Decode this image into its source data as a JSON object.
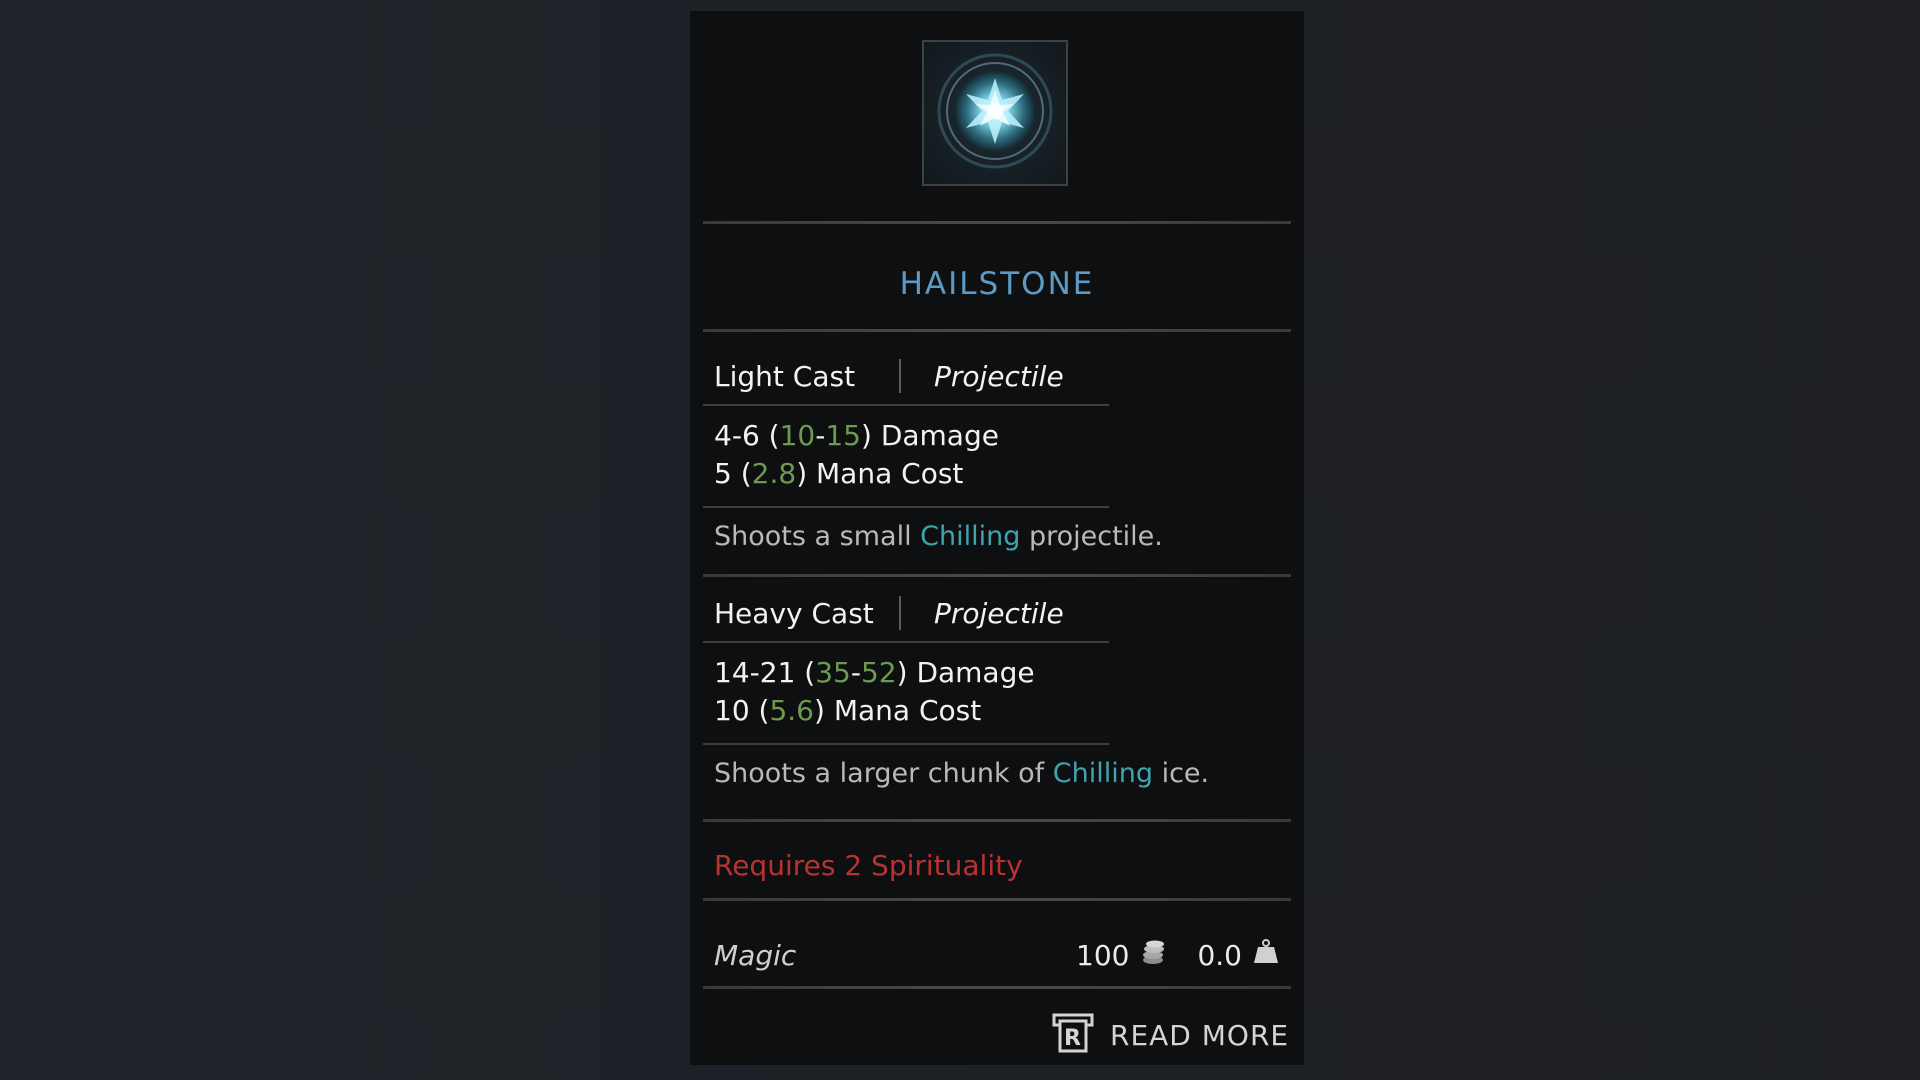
{
  "spell": {
    "name": "HAILSTONE",
    "icon": "ice-orb-icon"
  },
  "light_cast": {
    "label": "Light Cast",
    "type": "Projectile",
    "damage": {
      "base_min": "4",
      "base_max": "6",
      "scaled_min": "10",
      "scaled_max": "15",
      "label": "Damage"
    },
    "mana": {
      "base": "5",
      "scaled": "2.8",
      "label": "Mana Cost"
    },
    "description": {
      "before": "Shoots a small ",
      "keyword": "Chilling",
      "after": " projectile."
    }
  },
  "heavy_cast": {
    "label": "Heavy Cast",
    "type": "Projectile",
    "damage": {
      "base_min": "14",
      "base_max": "21",
      "scaled_min": "35",
      "scaled_max": "52",
      "label": "Damage"
    },
    "mana": {
      "base": "10",
      "scaled": "5.6",
      "label": "Mana Cost"
    },
    "description": {
      "before": "Shoots a larger chunk of ",
      "keyword": "Chilling",
      "after": " ice."
    }
  },
  "requirement": "Requires 2 Spirituality",
  "footer": {
    "category": "Magic",
    "value": "100",
    "value_icon": "coins-icon",
    "weight": "0.0",
    "weight_icon": "weight-icon"
  },
  "read_more": {
    "key": "R",
    "label": "READ MORE"
  },
  "colors": {
    "title": "#5f9ac4",
    "scaled_value": "#6c9a4e",
    "keyword": "#3fa3b0",
    "requirement": "#b83232"
  }
}
